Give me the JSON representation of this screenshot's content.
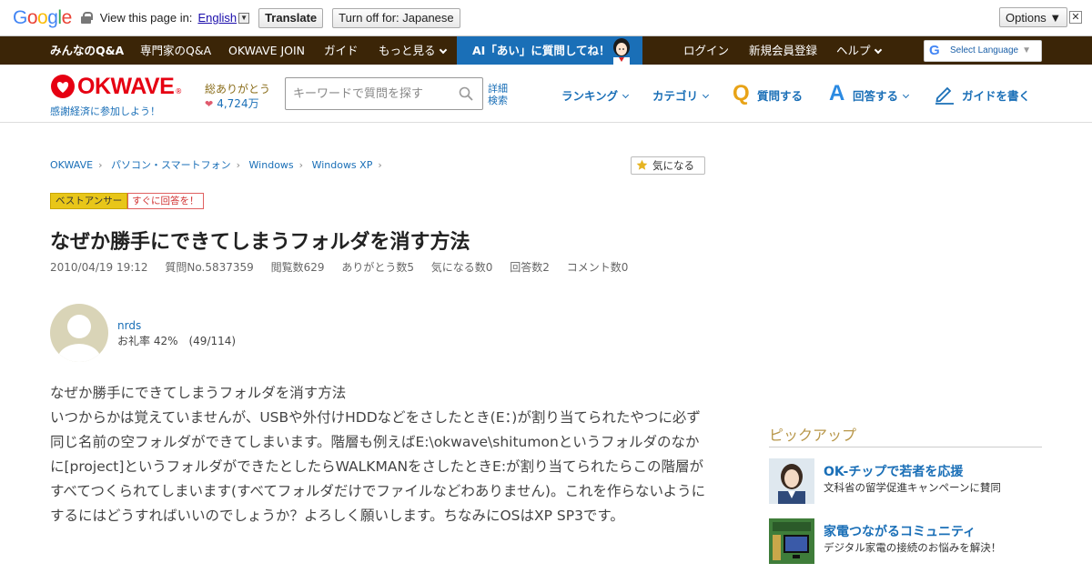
{
  "translate_bar": {
    "logo": "Google",
    "view_text": "View this page in:",
    "language": "English",
    "translate_button": "Translate",
    "turn_off_button": "Turn off for: Japanese",
    "options_button": "Options ▼",
    "close": "✕"
  },
  "nav": {
    "items": [
      "みんなのQ&A",
      "専門家のQ&A",
      "OKWAVE JOIN",
      "ガイド",
      "もっと見る"
    ],
    "ai_banner": "AI「あい」に質問してね！",
    "right_items": [
      "ログイン",
      "新規会員登録",
      "ヘルプ"
    ],
    "select_language": "Select Language",
    "select_language_arrow": "▼"
  },
  "header": {
    "logo_text": "OKWAVE",
    "logo_reg": "®",
    "slogan": "感謝経済に参加しよう！",
    "thanks_label": "総ありがとう",
    "thanks_count": "4,724万",
    "search_placeholder": "キーワードで質問を探す",
    "advanced_search_1": "詳細",
    "advanced_search_2": "検索",
    "ranking": "ランキング",
    "category": "カテゴリ",
    "ask_letter": "Q",
    "ask": "質問する",
    "answer_letter": "A",
    "answer": "回答する",
    "write_guide": "ガイドを書く"
  },
  "breadcrumb": [
    "OKWAVE",
    "パソコン・スマートフォン",
    "Windows",
    "Windows XP"
  ],
  "watch_button": "気になる",
  "badges": {
    "best_answer": "ベストアンサー",
    "answer_now": "すぐに回答を！"
  },
  "question": {
    "title": "なぜか勝手にできてしまうフォルダを消す方法",
    "meta": [
      "2010/04/19 19:12",
      "質問No.5837359",
      "閲覧数629",
      "ありがとう数5",
      "気になる数0",
      "回答数2",
      "コメント数0"
    ],
    "user_name": "nrds",
    "user_rate": "お礼率 42%　(49/114)",
    "body_lines": [
      "なぜか勝手にできてしまうフォルダを消す方法",
      "いつからかは覚えていませんが、USBや外付けHDDなどをさしたとき(E：)が割り当てられたやつに必ず同じ名前の空フォルダができてしまいます。階層も例えばE:\\okwave\\shitumonというフォルダのなかに[project]というフォルダができたとしたらWALKMANをさしたときE:が割り当てられたらこの階層がすべてつくられてしまいます(すべてフォルダだけでファイルなどわありません)。これを作らないようにするにはどうすればいいのでしょうか？よろしく願いします。ちなみにOSはXP SP3です。"
    ]
  },
  "pickup": {
    "heading": "ピックアップ",
    "items": [
      {
        "title": "OK-チップで若者を応援",
        "subtitle": "文科省の留学促進キャンペーンに賛同"
      },
      {
        "title": "家電つながるコミュニティ",
        "subtitle": "デジタル家電の接続のお悩みを解決！"
      }
    ]
  }
}
